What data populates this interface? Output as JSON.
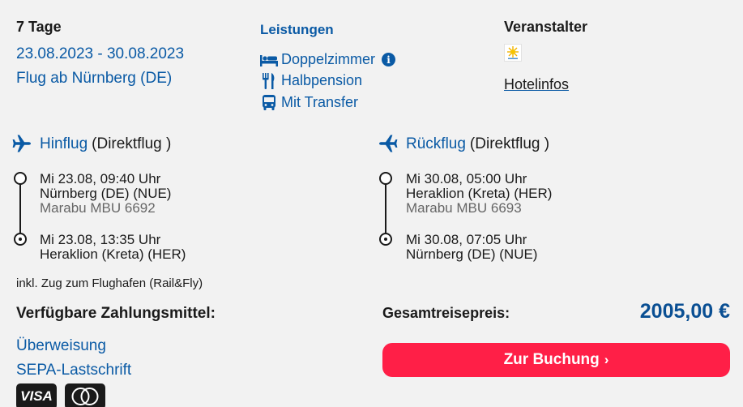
{
  "trip": {
    "days": "7 Tage",
    "dates": "23.08.2023 - 30.08.2023",
    "flight_from": "Flug ab Nürnberg (DE)"
  },
  "services": {
    "title": "Leistungen",
    "items": [
      {
        "icon": "bed-icon",
        "label": "Doppelzimmer"
      },
      {
        "icon": "cutlery-icon",
        "label": "Halbpension"
      },
      {
        "icon": "bus-icon",
        "label": "Mit Transfer"
      }
    ],
    "info_glyph": "i"
  },
  "organizer": {
    "title": "Veranstalter",
    "hotelinfos": "Hotelinfos"
  },
  "outbound": {
    "label": "Hinflug",
    "type": "(Direktflug )",
    "departure": {
      "time": "Mi 23.08, 09:40 Uhr",
      "airport": "Nürnberg (DE) (NUE)",
      "carrier": "Marabu MBU 6692"
    },
    "arrival": {
      "time": "Mi 23.08, 13:35 Uhr",
      "airport": "Heraklion (Kreta) (HER)"
    }
  },
  "return": {
    "label": "Rückflug",
    "type": "(Direktflug )",
    "departure": {
      "time": "Mi 30.08, 05:00 Uhr",
      "airport": "Heraklion (Kreta) (HER)",
      "carrier": "Marabu MBU 6693"
    },
    "arrival": {
      "time": "Mi 30.08, 07:05 Uhr",
      "airport": "Nürnberg (DE) (NUE)"
    }
  },
  "rail_note": "inkl. Zug zum Flughafen (Rail&Fly)",
  "payment": {
    "title": "Verfügbare Zahlungsmittel:",
    "methods": [
      "Überweisung",
      "SEPA-Lastschrift"
    ],
    "visa_label": "VISA"
  },
  "total": {
    "label": "Gesamtreisepreis:",
    "price": "2005,00 €"
  },
  "booking": {
    "button_label": "Zur Buchung",
    "chevron": "›"
  },
  "colors": {
    "link_blue": "#0a5aa5",
    "price_blue": "#0a4f93",
    "cta_red": "#ff1f47",
    "background": "#f2f2f2"
  }
}
